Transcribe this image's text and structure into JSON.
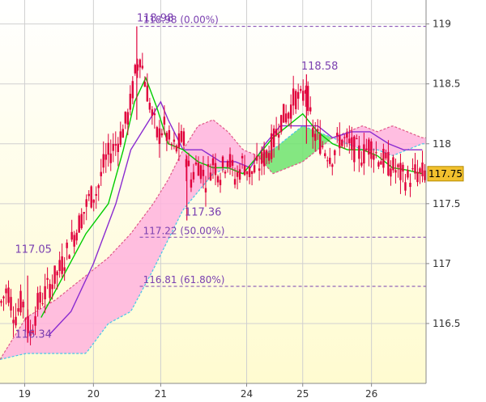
{
  "chart_data": {
    "type": "candlestick",
    "y_ticks": [
      "119",
      "118.5",
      "118",
      "117.5",
      "117",
      "116.5"
    ],
    "y_tick_values": [
      119,
      118.5,
      118,
      117.5,
      117,
      116.5
    ],
    "ylim": [
      116.0,
      119.2
    ],
    "x_ticks": [
      "19",
      "20",
      "21",
      "24",
      "25",
      "26"
    ],
    "x_tick_positions": [
      0.08,
      1.0,
      1.9,
      3.05,
      3.8,
      4.72
    ],
    "xlim": [
      -0.25,
      5.45
    ],
    "last_price": "117.75",
    "last_price_value": 117.75,
    "grid": true,
    "fib_levels": [
      {
        "label": "118.98 (0.00%)",
        "value": 118.98
      },
      {
        "label": "117.22 (50.00%)",
        "value": 117.22
      },
      {
        "label": "116.81 (61.80%)",
        "value": 116.81
      }
    ],
    "annotations": [
      {
        "text": "118.98",
        "x": 1.58,
        "y": 118.98
      },
      {
        "text": "118.58",
        "x": 3.78,
        "y": 118.58
      },
      {
        "text": "117.05",
        "x": -0.05,
        "y": 117.05
      },
      {
        "text": "117.36",
        "x": 2.22,
        "y": 117.36
      },
      {
        "text": "116.34",
        "x": -0.05,
        "y": 116.34
      }
    ],
    "price_path": [
      [
        -0.25,
        116.65
      ],
      [
        -0.15,
        116.8
      ],
      [
        -0.05,
        116.55
      ],
      [
        0.05,
        116.7
      ],
      [
        0.15,
        116.4
      ],
      [
        0.25,
        116.65
      ],
      [
        0.35,
        116.75
      ],
      [
        0.45,
        116.85
      ],
      [
        0.55,
        116.95
      ],
      [
        0.65,
        117.1
      ],
      [
        0.75,
        117.25
      ],
      [
        0.85,
        117.4
      ],
      [
        0.95,
        117.55
      ],
      [
        1.05,
        117.6
      ],
      [
        1.15,
        117.85
      ],
      [
        1.25,
        117.95
      ],
      [
        1.35,
        118.05
      ],
      [
        1.45,
        118.2
      ],
      [
        1.5,
        118.35
      ],
      [
        1.55,
        118.55
      ],
      [
        1.62,
        118.75
      ],
      [
        1.7,
        118.5
      ],
      [
        1.78,
        118.25
      ],
      [
        1.86,
        118.05
      ],
      [
        1.94,
        118.15
      ],
      [
        2.02,
        118.0
      ],
      [
        2.1,
        117.95
      ],
      [
        2.2,
        118.05
      ],
      [
        2.3,
        117.7
      ],
      [
        2.4,
        117.85
      ],
      [
        2.5,
        117.7
      ],
      [
        2.6,
        117.85
      ],
      [
        2.7,
        117.75
      ],
      [
        2.8,
        117.9
      ],
      [
        2.9,
        117.7
      ],
      [
        3.0,
        117.85
      ],
      [
        3.1,
        117.75
      ],
      [
        3.2,
        117.8
      ],
      [
        3.3,
        117.9
      ],
      [
        3.4,
        118.0
      ],
      [
        3.5,
        118.2
      ],
      [
        3.6,
        118.25
      ],
      [
        3.7,
        118.4
      ],
      [
        3.78,
        118.35
      ],
      [
        3.85,
        118.5
      ],
      [
        3.92,
        118.1
      ],
      [
        4.0,
        118.05
      ],
      [
        4.1,
        117.95
      ],
      [
        4.2,
        117.9
      ],
      [
        4.3,
        118.05
      ],
      [
        4.4,
        118.0
      ],
      [
        4.5,
        117.95
      ],
      [
        4.6,
        117.9
      ],
      [
        4.7,
        118.0
      ],
      [
        4.8,
        117.9
      ],
      [
        4.9,
        117.85
      ],
      [
        5.0,
        117.8
      ],
      [
        5.1,
        117.75
      ],
      [
        5.2,
        117.7
      ],
      [
        5.3,
        117.75
      ],
      [
        5.4,
        117.75
      ]
    ],
    "tenkan": [
      [
        0.3,
        116.55
      ],
      [
        0.6,
        116.9
      ],
      [
        0.9,
        117.25
      ],
      [
        1.2,
        117.5
      ],
      [
        1.4,
        117.95
      ],
      [
        1.55,
        118.35
      ],
      [
        1.7,
        118.55
      ],
      [
        1.85,
        118.3
      ],
      [
        2.0,
        118.0
      ],
      [
        2.2,
        117.95
      ],
      [
        2.4,
        117.85
      ],
      [
        2.6,
        117.8
      ],
      [
        2.8,
        117.8
      ],
      [
        3.0,
        117.75
      ],
      [
        3.2,
        117.9
      ],
      [
        3.4,
        118.05
      ],
      [
        3.6,
        118.15
      ],
      [
        3.8,
        118.25
      ],
      [
        4.0,
        118.1
      ],
      [
        4.2,
        118.0
      ],
      [
        4.4,
        117.95
      ],
      [
        4.6,
        117.95
      ],
      [
        4.8,
        117.9
      ],
      [
        5.0,
        117.8
      ],
      [
        5.2,
        117.78
      ],
      [
        5.4,
        117.75
      ]
    ],
    "kijun": [
      [
        0.4,
        116.4
      ],
      [
        0.7,
        116.6
      ],
      [
        1.0,
        117.0
      ],
      [
        1.3,
        117.5
      ],
      [
        1.5,
        117.95
      ],
      [
        1.7,
        118.15
      ],
      [
        1.9,
        118.35
      ],
      [
        2.0,
        118.2
      ],
      [
        2.2,
        117.95
      ],
      [
        2.45,
        117.95
      ],
      [
        2.7,
        117.85
      ],
      [
        2.9,
        117.85
      ],
      [
        3.1,
        117.8
      ],
      [
        3.3,
        118.0
      ],
      [
        3.5,
        118.15
      ],
      [
        3.8,
        118.15
      ],
      [
        4.0,
        118.15
      ],
      [
        4.2,
        118.05
      ],
      [
        4.45,
        118.1
      ],
      [
        4.7,
        118.1
      ],
      [
        4.95,
        118.0
      ],
      [
        5.15,
        117.95
      ],
      [
        5.4,
        117.95
      ]
    ],
    "cloud_span_a": [
      [
        -0.25,
        116.2
      ],
      [
        0.1,
        116.25
      ],
      [
        0.5,
        116.25
      ],
      [
        0.9,
        116.25
      ],
      [
        1.2,
        116.5
      ],
      [
        1.5,
        116.6
      ],
      [
        1.8,
        116.95
      ],
      [
        2.0,
        117.2
      ],
      [
        2.2,
        117.45
      ],
      [
        2.4,
        117.6
      ],
      [
        2.6,
        117.75
      ],
      [
        2.8,
        117.8
      ],
      [
        3.0,
        117.75
      ],
      [
        3.2,
        117.9
      ],
      [
        3.4,
        117.95
      ],
      [
        3.6,
        118.05
      ],
      [
        3.8,
        118.15
      ],
      [
        4.0,
        118.1
      ],
      [
        4.2,
        118.05
      ],
      [
        4.4,
        118.0
      ],
      [
        4.6,
        117.95
      ],
      [
        4.8,
        117.95
      ],
      [
        5.0,
        117.9
      ],
      [
        5.2,
        117.95
      ],
      [
        5.4,
        118.0
      ]
    ],
    "cloud_span_b": [
      [
        -0.25,
        116.2
      ],
      [
        0.1,
        116.55
      ],
      [
        0.5,
        116.7
      ],
      [
        0.9,
        116.9
      ],
      [
        1.2,
        117.05
      ],
      [
        1.5,
        117.25
      ],
      [
        1.8,
        117.5
      ],
      [
        2.0,
        117.7
      ],
      [
        2.2,
        117.95
      ],
      [
        2.4,
        118.15
      ],
      [
        2.6,
        118.2
      ],
      [
        2.8,
        118.1
      ],
      [
        3.0,
        117.95
      ],
      [
        3.2,
        117.9
      ],
      [
        3.4,
        117.75
      ],
      [
        3.6,
        117.8
      ],
      [
        3.8,
        117.85
      ],
      [
        4.0,
        117.95
      ],
      [
        4.2,
        118.05
      ],
      [
        4.4,
        118.1
      ],
      [
        4.6,
        118.15
      ],
      [
        4.8,
        118.1
      ],
      [
        5.0,
        118.15
      ],
      [
        5.2,
        118.1
      ],
      [
        5.4,
        118.05
      ]
    ],
    "colors": {
      "candle": "#e0003c",
      "tenkan": "#00cc00",
      "kijun": "#8a2bd0",
      "cloud_bull": "#6ee36e",
      "cloud_bear": "#ffb3de",
      "fib": "#7a3fb0",
      "price_box": "#f2c12e",
      "grid": "#d0d0d0",
      "bg_top": "#ffffff",
      "bg_bottom": "#fffbd0"
    }
  }
}
